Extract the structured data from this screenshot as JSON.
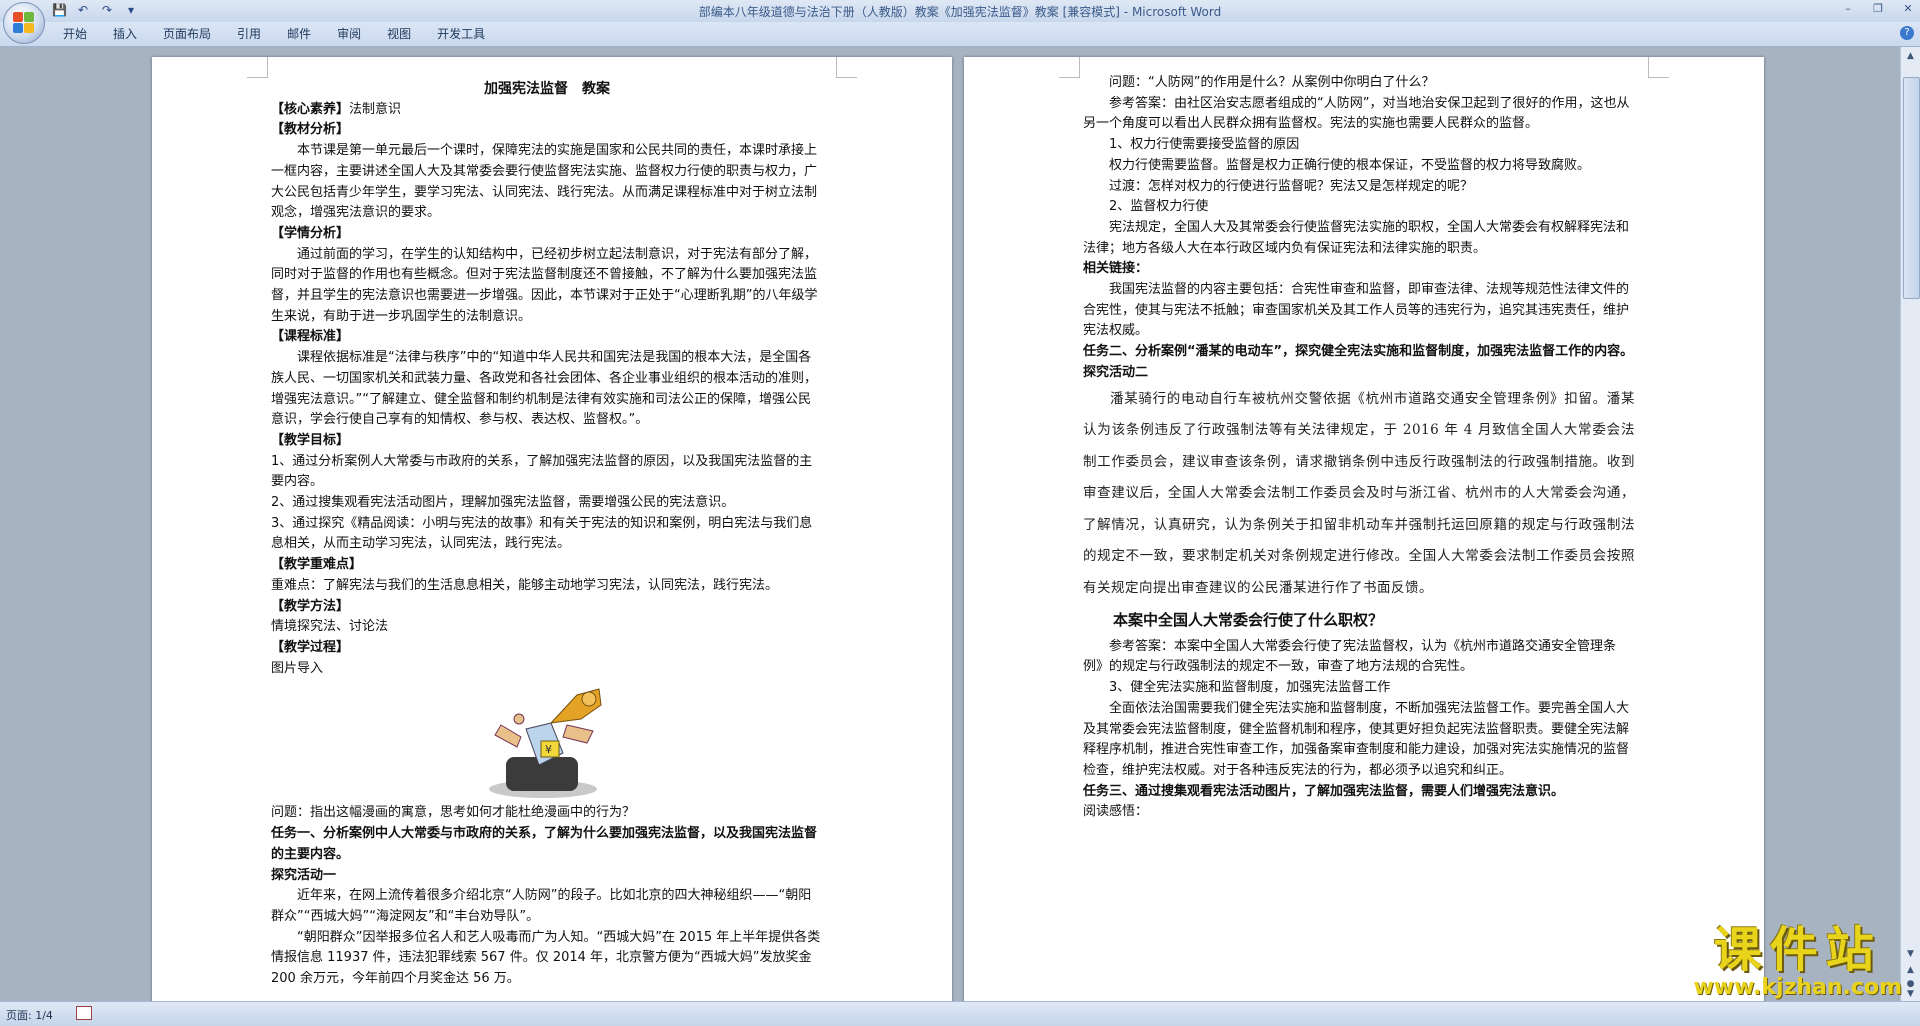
{
  "window": {
    "title": "部编本八年级道德与法治下册（人教版）教案《加强宪法监督》教案 [兼容模式]",
    "app_name": "Microsoft Word",
    "controls": [
      "minimize",
      "restore",
      "close"
    ]
  },
  "ribbon": {
    "tabs": [
      "开始",
      "插入",
      "页面布局",
      "引用",
      "邮件",
      "审阅",
      "视图",
      "开发工具"
    ]
  },
  "status": {
    "page": "页面: 1/4"
  },
  "watermark": {
    "cn": "课件站",
    "url": "www.kjzhan.com"
  },
  "doc_left": {
    "title": "加强宪法监督　教案",
    "core_h": "【核心素养】",
    "core_t": "法制意识",
    "material_h": "【教材分析】",
    "material_p": "本节课是第一单元最后一个课时，保障宪法的实施是国家和公民共同的责任，本课时承接上一框内容，主要讲述全国人大及其常委会要行使监督宪法实施、监督权力行使的职责与权力，广大公民包括青少年学生，要学习宪法、认同宪法、践行宪法。从而满足课程标准中对于树立法制观念，增强宪法意识的要求。",
    "student_h": "【学情分析】",
    "student_p": "通过前面的学习，在学生的认知结构中，已经初步树立起法制意识，对于宪法有部分了解，同时对于监督的作用也有些概念。但对于宪法监督制度还不曾接触，不了解为什么要加强宪法监督，并且学生的宪法意识也需要进一步增强。因此，本节课对于正处于“心理断乳期”的八年级学生来说，有助于进一步巩固学生的法制意识。",
    "standard_h": "【课程标准】",
    "standard_p": "课程依据标准是“法律与秩序”中的“知道中华人民共和国宪法是我国的根本大法，是全国各族人民、一切国家机关和武装力量、各政党和各社会团体、各企业事业组织的根本活动的准则，增强宪法意识。”“了解建立、健全监督和制约机制是法律有效实施和司法公正的保障，增强公民意识，学会行使自己享有的知情权、参与权、表达权、监督权。”。",
    "goal_h": "【教学目标】",
    "goal_1": "1、通过分析案例人大常委与市政府的关系，了解加强宪法监督的原因，以及我国宪法监督的主要内容。",
    "goal_2": "2、通过搜集观看宪法活动图片，理解加强宪法监督，需要增强公民的宪法意识。",
    "goal_3": "3、通过探究《精品阅读：小明与宪法的故事》和有关于宪法的知识和案例，明白宪法与我们息息相关，从而主动学习宪法，认同宪法，践行宪法。",
    "key_h": "【教学重难点】",
    "key_p": "重难点：了解宪法与我们的生活息息相关，能够主动地学习宪法，认同宪法，践行宪法。",
    "method_h": "【教学方法】",
    "method_p": "情境探究法、讨论法",
    "process_h": "【教学过程】",
    "process_p": "图片导入",
    "image_label": "¥",
    "question": "问题：指出这幅漫画的寓意，思考如何才能杜绝漫画中的行为？",
    "task1": "任务一、分析案例中人大常委与市政府的关系，了解为什么要加强宪法监督，以及我国宪法监督的主要内容。",
    "explore1": "探究活动一",
    "para1": "近年来，在网上流传着很多介绍北京“人防网”的段子。比如北京的四大神秘组织——“朝阳群众”“西城大妈”“海淀网友”和“丰台劝导队”。",
    "para2": "“朝阳群众”因举报多位名人和艺人吸毒而广为人知。“西城大妈”在 2015 年上半年提供各类情报信息 11937 件，违法犯罪线索 567 件。仅 2014 年，北京警方便为“西城大妈”发放奖金 200 余万元，今年前四个月奖金达 56 万。"
  },
  "doc_right": {
    "q1": "问题：“人防网”的作用是什么？从案例中你明白了什么？",
    "a1": "参考答案：由社区治安志愿者组成的“人防网”，对当地治安保卫起到了很好的作用，这也从另一个角度可以看出人民群众拥有监督权。宪法的实施也需要人民群众的监督。",
    "s1": "1、权力行使需要接受监督的原因",
    "s1p": "权力行使需要监督。监督是权力正确行使的根本保证，不受监督的权力将导致腐败。",
    "trans": "过渡：怎样对权力的行使进行监督呢？宪法又是怎样规定的呢？",
    "s2": "2、监督权力行使",
    "s2p": "宪法规定，全国人大及其常委会行使监督宪法实施的职权，全国人大常委会有权解释宪法和法律；地方各级人大在本行政区域内负有保证宪法和法律实施的职责。",
    "link_h": "相关链接：",
    "link_p": "我国宪法监督的内容主要包括：合宪性审查和监督，即审查法律、法规等规范性法律文件的合宪性，使其与宪法不抵触；审查国家机关及其工作人员等的违宪行为，追究其违宪责任，维护宪法权威。",
    "task2": "任务二、分析案例“潘某的电动车”，探究健全宪法实施和监督制度，加强宪法监督工作的内容。",
    "explore2": "探究活动二",
    "case": "潘某骑行的电动自行车被杭州交警依据《杭州市道路交通安全管理条例》扣留。潘某认为该条例违反了行政强制法等有关法律规定，于 2016 年 4 月致信全国人大常委会法制工作委员会，建议审查该条例，请求撤销条例中违反行政强制法的行政强制措施。收到审查建议后，全国人大常委会法制工作委员会及时与浙江省、杭州市的人大常委会沟通，了解情况，认真研究，认为条例关于扣留非机动车并强制托运回原籍的规定与行政强制法的规定不一致，要求制定机关对条例规定进行修改。全国人大常委会法制工作委员会按照有关规定向提出审查建议的公民潘某进行作了书面反馈。",
    "q2": "本案中全国人大常委会行使了什么职权？",
    "a2": "参考答案：本案中全国人大常委会行使了宪法监督权，认为《杭州市道路交通安全管理条例》的规定与行政强制法的规定不一致，审查了地方法规的合宪性。",
    "s3": "3、健全宪法实施和监督制度，加强宪法监督工作",
    "s3p": "全面依法治国需要我们健全宪法实施和监督制度，不断加强宪法监督工作。要完善全国人大及其常委会宪法监督制度，健全监督机制和程序，使其更好担负起宪法监督职责。要健全宪法解释程序机制，推进合宪性审查工作，加强备案审查制度和能力建设，加强对宪法实施情况的监督检查，维护宪法权威。对于各种违反宪法的行为，都必须予以追究和纠正。",
    "task3": "任务三、通过搜集观看宪法活动图片，了解加强宪法监督，需要人们增强宪法意识。",
    "read": "阅读感悟："
  }
}
